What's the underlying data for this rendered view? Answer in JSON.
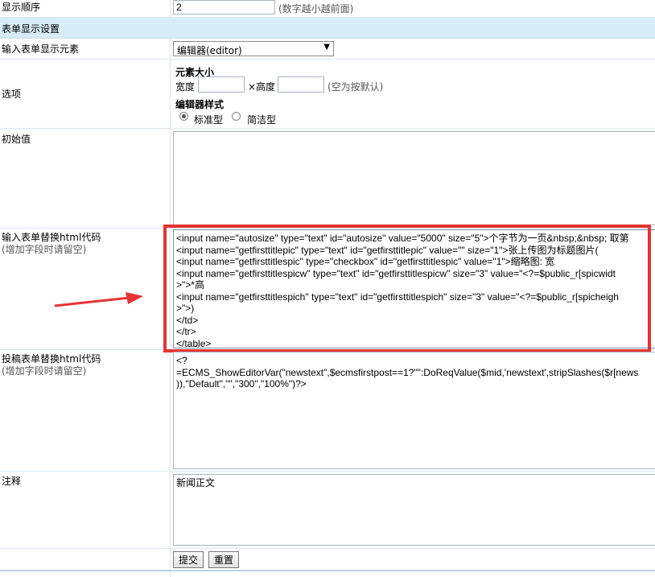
{
  "display_order": {
    "label": "显示顺序",
    "value": "2",
    "hint": "(数字越小越前面)"
  },
  "section_title": "表单显示设置",
  "input_element": {
    "label": "输入表单显示元素",
    "selected": "编辑器(editor)"
  },
  "options": {
    "label": "选项",
    "size_title": "元素大小",
    "width_label": "宽度",
    "height_label": "×高度",
    "size_hint": "(空为按默认)",
    "editor_style_title": "编辑器样式",
    "style_standard": "标准型",
    "style_simple": "简洁型"
  },
  "initial_value": {
    "label": "初始值",
    "value": ""
  },
  "input_html": {
    "label": "输入表单替换html代码",
    "sub": "(增加字段时请留空)",
    "code": "<input name=\"autosize\" type=\"text\" id=\"autosize\" value=\"5000\" size=\"5\">个字节为一页&nbsp;&nbsp; 取第\n<input name=\"getfirsttitlepic\" type=\"text\" id=\"getfirsttitlepic\" value=\"\" size=\"1\">张上传图为标题图片(\n<input name=\"getfirsttitlespic\" type=\"checkbox\" id=\"getfirsttitlespic\" value=\"1\">缩略图: 宽\n<input name=\"getfirsttitlespicw\" type=\"text\" id=\"getfirsttitlespicw\" size=\"3\" value=\"<?=$public_r[spicwidt\n>\">*高\n<input name=\"getfirsttitlespich\" type=\"text\" id=\"getfirsttitlespich\" size=\"3\" value=\"<?=$public_r[spicheigh\n>\">)\n</td>\n</tr>\n</table>"
  },
  "submit_html": {
    "label": "投稿表单替换html代码",
    "sub": "(增加字段时请留空)",
    "code": "<?\n=ECMS_ShowEditorVar(\"newstext\",$ecmsfirstpost==1?\"\":DoReqValue($mid,'newstext',stripSlashes($r[news\n)),\"Default\",\"\",\"300\",\"100%\")?>"
  },
  "note": {
    "label": "注释",
    "value": "新闻正文"
  },
  "buttons": {
    "submit": "提交",
    "reset": "重置"
  },
  "colors": {
    "highlight_box": "#e83232",
    "arrow": "#e83232",
    "section_bg": "#d6ecf6"
  }
}
